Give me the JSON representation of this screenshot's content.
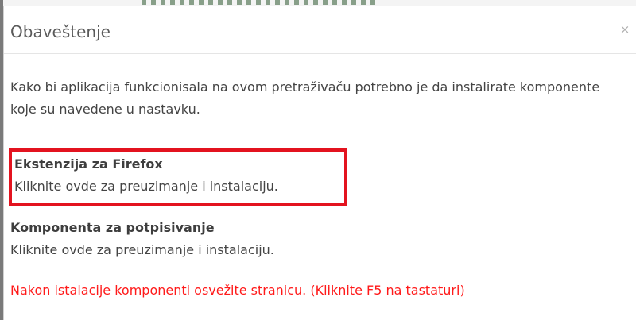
{
  "modal": {
    "title": "Obaveštenje",
    "close_symbol": "×"
  },
  "body": {
    "intro": "Kako bi aplikacija funkcionisala na ovom pretraživaču potrebno je da instalirate komponente koje su navedene u nastavku.",
    "components": [
      {
        "title": "Ekstenzija za Firefox",
        "link": "Kliknite ovde za preuzimanje i instalaciju.",
        "highlighted": true
      },
      {
        "title": "Komponenta za potpisivanje",
        "link": "Kliknite ovde za preuzimanje i instalaciju.",
        "highlighted": false
      }
    ],
    "notice": "Nakon istalacije komponenti osvežite stranicu. (Kliknite F5 na tastaturi)"
  },
  "colors": {
    "highlight_border": "#e3131f",
    "notice_text": "#ff1a1a",
    "title_text": "#5a5a5a"
  },
  "icons": {
    "close": "close-icon"
  }
}
